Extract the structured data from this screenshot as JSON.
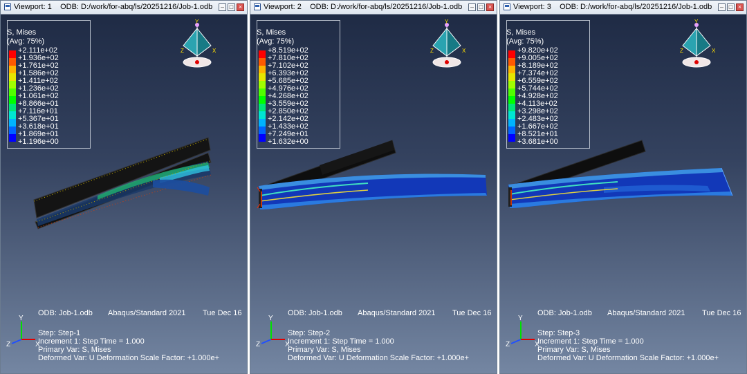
{
  "viewports": [
    {
      "title": "Viewport: 1",
      "odb_path": "ODB: D:/work/for-abq/ls/20251216/Job-1.odb",
      "legend_title_1": "S, Mises",
      "legend_title_2": "(Avg: 75%)",
      "legend_values": [
        "+2.111e+02",
        "+1.936e+02",
        "+1.761e+02",
        "+1.586e+02",
        "+1.411e+02",
        "+1.236e+02",
        "+1.061e+02",
        "+8.866e+01",
        "+7.116e+01",
        "+5.367e+01",
        "+3.618e+01",
        "+1.869e+01",
        "+1.196e+00"
      ],
      "info_odb": "ODB: Job-1.odb",
      "info_solver": "Abaqus/Standard 2021",
      "info_date": "Tue Dec 16",
      "step": "Step: Step-1",
      "increment": "Increment      1: Step Time =     1.000",
      "primary_var": "Primary Var: S, Mises",
      "deformed_var": "Deformed Var: U   Deformation Scale Factor: +1.000e+"
    },
    {
      "title": "Viewport: 2",
      "odb_path": "ODB: D:/work/for-abq/ls/20251216/Job-1.odb",
      "legend_title_1": "S, Mises",
      "legend_title_2": "(Avg: 75%)",
      "legend_values": [
        "+8.519e+02",
        "+7.810e+02",
        "+7.102e+02",
        "+6.393e+02",
        "+5.685e+02",
        "+4.976e+02",
        "+4.268e+02",
        "+3.559e+02",
        "+2.850e+02",
        "+2.142e+02",
        "+1.433e+02",
        "+7.249e+01",
        "+1.632e+00"
      ],
      "info_odb": "ODB: Job-1.odb",
      "info_solver": "Abaqus/Standard 2021",
      "info_date": "Tue Dec 16",
      "step": "Step: Step-2",
      "increment": "Increment      1: Step Time =     1.000",
      "primary_var": "Primary Var: S, Mises",
      "deformed_var": "Deformed Var: U   Deformation Scale Factor: +1.000e+"
    },
    {
      "title": "Viewport: 3",
      "odb_path": "ODB: D:/work/for-abq/ls/20251216/Job-1.odb",
      "legend_title_1": "S, Mises",
      "legend_title_2": "(Avg: 75%)",
      "legend_values": [
        "+9.820e+02",
        "+9.005e+02",
        "+8.189e+02",
        "+7.374e+02",
        "+6.559e+02",
        "+5.744e+02",
        "+4.928e+02",
        "+4.113e+02",
        "+3.298e+02",
        "+2.483e+02",
        "+1.667e+02",
        "+8.521e+01",
        "+3.681e+00"
      ],
      "info_odb": "ODB: Job-1.odb",
      "info_solver": "Abaqus/Standard 2021",
      "info_date": "Tue Dec 16",
      "step": "Step: Step-3",
      "increment": "Increment      1: Step Time =     1.000",
      "primary_var": "Primary Var: S, Mises",
      "deformed_var": "Deformed Var: U   Deformation Scale Factor: +1.000e+"
    }
  ],
  "legend_colors": [
    "#ff0000",
    "#ff5a00",
    "#ffb400",
    "#e6e600",
    "#a0ff00",
    "#50ff00",
    "#00ff00",
    "#00e678",
    "#00e6d2",
    "#00b4ff",
    "#0064ff",
    "#0000ff"
  ],
  "triad_labels": {
    "y": "Y",
    "z": "Z",
    "x": "X"
  },
  "colors": {
    "bg_top": "#1f2b45",
    "bg_bottom": "#7486a2",
    "text": "#ffffff"
  }
}
